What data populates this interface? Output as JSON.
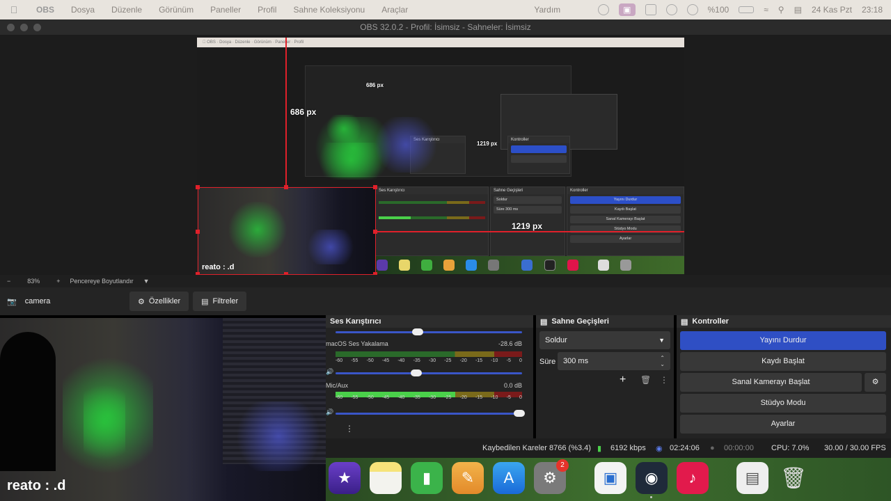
{
  "menubar": {
    "app": "OBS",
    "items": [
      "Dosya",
      "Düzenle",
      "Görünüm",
      "Paneller",
      "Profil",
      "Sahne Koleksiyonu",
      "Araçlar"
    ],
    "help": "Yardım",
    "battery": "%100",
    "date": "24 Kas Pzt",
    "time": "23:18"
  },
  "window": {
    "title": "OBS 32.0.2 - Profil: İsimsiz - Sahneler: İsimsiz"
  },
  "preview": {
    "label_686": "686 px",
    "label_1219": "1219 px",
    "nested_686": "686 px",
    "nested_1219": "1219 px",
    "watermark": "reato : .d"
  },
  "zoombar": {
    "minus": "−",
    "zoom": "83%",
    "plus": "+",
    "fit": "Pencereye Boyutlandır"
  },
  "toolbar": {
    "source": "camera",
    "properties": "Özellikler",
    "filters": "Filtreler"
  },
  "camera": {
    "watermark": "reato : .d"
  },
  "mixer": {
    "title": "Ses Karıştırıcı",
    "channels": [
      {
        "name": "macOS Ses Yakalama",
        "level": "-28.6 dB"
      },
      {
        "name": "Mic/Aux",
        "level": "0.0 dB"
      }
    ],
    "ticks": [
      "-60",
      "-55",
      "-50",
      "-45",
      "-40",
      "-35",
      "-30",
      "-25",
      "-20",
      "-15",
      "-10",
      "-5",
      "0"
    ]
  },
  "transitions": {
    "title": "Sahne Geçişleri",
    "type": "Soldur",
    "duration_label": "Süre",
    "duration": "300 ms"
  },
  "controls": {
    "title": "Kontroller",
    "stop_stream": "Yayını Durdur",
    "start_record": "Kaydı Başlat",
    "virtual_cam": "Sanal Kamerayı Başlat",
    "studio_mode": "Stüdyo Modu",
    "settings": "Ayarlar"
  },
  "status": {
    "dropped": "Kaybedilen Kareler 8766 (%3.4)",
    "bitrate": "6192 kbps",
    "stream_time": "02:24:06",
    "record_time": "00:00:00",
    "cpu": "CPU: 7.0%",
    "fps": "30.00 / 30.00 FPS"
  },
  "dock": {
    "settings_badge": "2"
  },
  "colors": {
    "accent": "#2f4fc4",
    "selection": "#e0202a"
  }
}
